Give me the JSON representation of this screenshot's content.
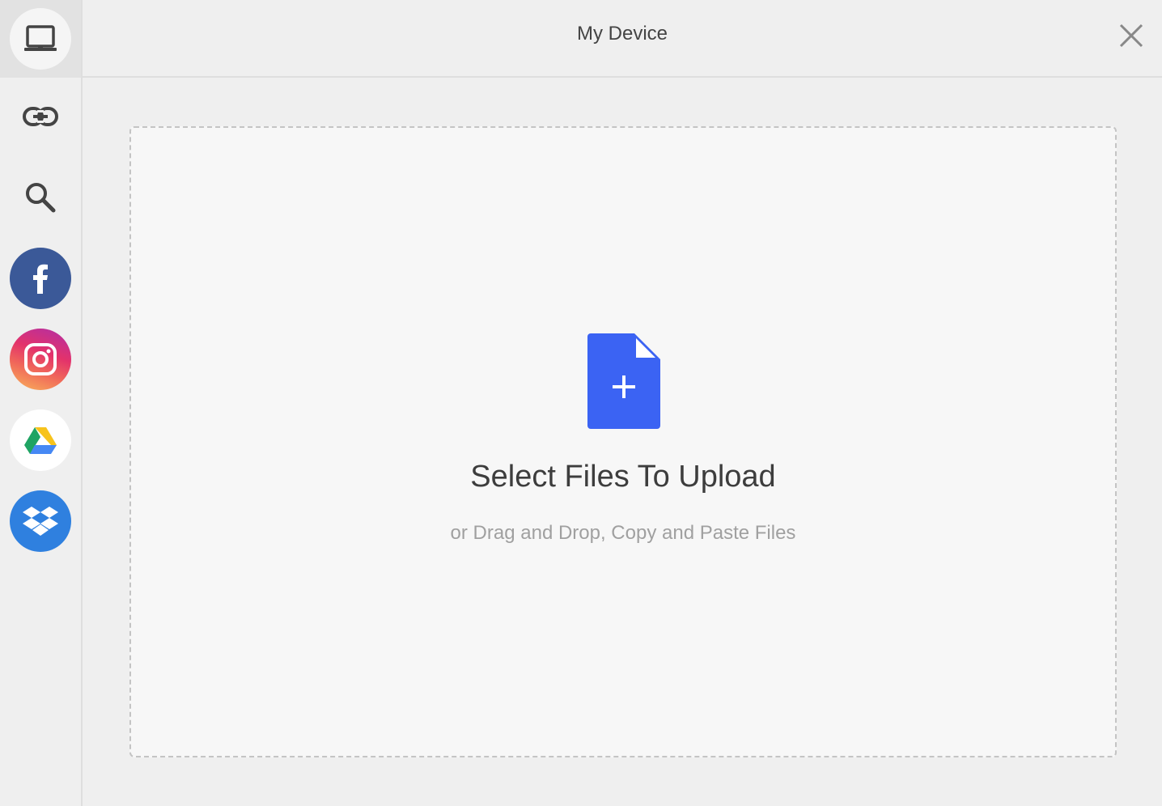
{
  "header": {
    "title": "My Device"
  },
  "sidebar": {
    "items": [
      {
        "id": "my-device",
        "icon": "laptop-icon",
        "active": true
      },
      {
        "id": "link",
        "icon": "link-icon",
        "active": false
      },
      {
        "id": "search",
        "icon": "search-icon",
        "active": false
      },
      {
        "id": "facebook",
        "icon": "facebook-icon",
        "active": false
      },
      {
        "id": "instagram",
        "icon": "instagram-icon",
        "active": false
      },
      {
        "id": "google-drive",
        "icon": "google-drive-icon",
        "active": false
      },
      {
        "id": "dropbox",
        "icon": "dropbox-icon",
        "active": false
      }
    ]
  },
  "dropzone": {
    "title": "Select Files To Upload",
    "subtitle": "or Drag and Drop, Copy and Paste Files",
    "icon": "file-add-icon"
  },
  "colors": {
    "accent": "#3b63f3",
    "facebook": "#3b5998",
    "dropbox": "#2f80df",
    "background": "#efefef",
    "dropzone_bg": "#f7f7f7"
  }
}
